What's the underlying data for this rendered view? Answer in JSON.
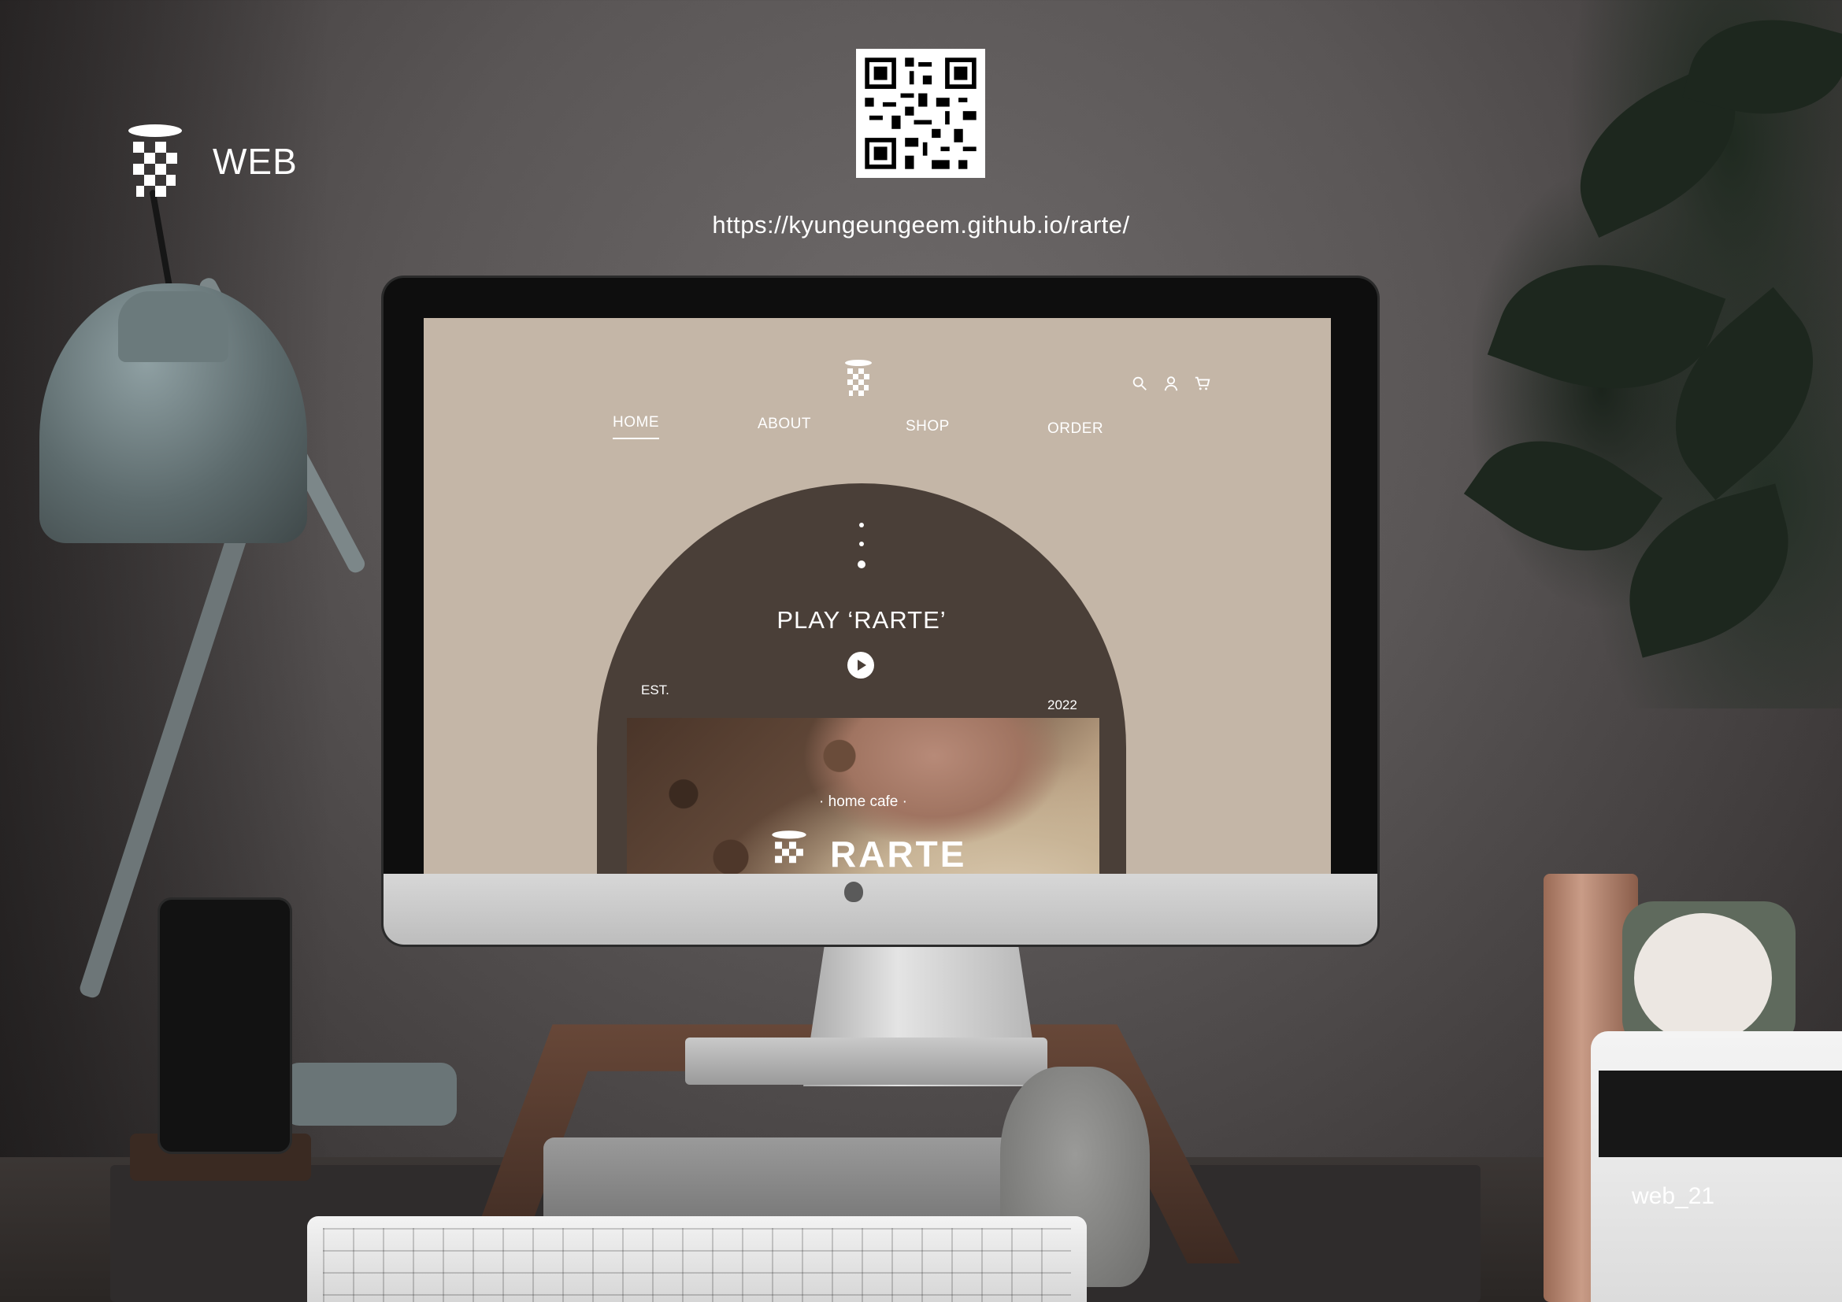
{
  "overlay": {
    "section_label": "WEB",
    "url": "https://kyungeungeem.github.io/rarte/",
    "page_number": "web_21"
  },
  "site": {
    "header_icons": [
      "search-icon",
      "user-icon",
      "cart-icon"
    ],
    "nav": [
      {
        "label": "HOME",
        "active": true
      },
      {
        "label": "ABOUT",
        "active": false
      },
      {
        "label": "SHOP",
        "active": false
      },
      {
        "label": "ORDER",
        "active": false
      }
    ],
    "hero": {
      "title": "PLAY ‘RARTE’",
      "est_label": "EST.",
      "year": "2022",
      "tagline": "· home cafe ·",
      "brand": "RARTE"
    },
    "colors": {
      "background": "#c4b6a7",
      "arch": "#4a3f38",
      "text": "#ffffff"
    }
  }
}
